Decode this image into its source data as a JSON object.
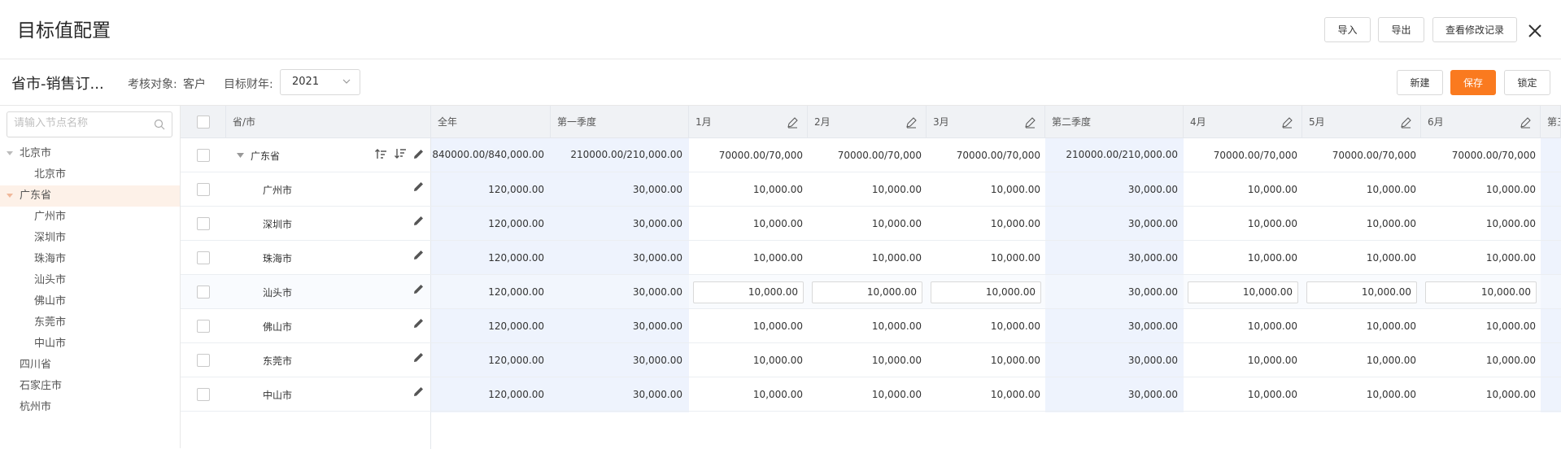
{
  "header": {
    "title": "目标值配置",
    "buttons": {
      "import": "导入",
      "export": "导出",
      "history": "查看修改记录"
    }
  },
  "toolbar": {
    "title": "省市-销售订...",
    "target_label": "考核对象:",
    "target_value": "客户",
    "year_label": "目标财年:",
    "year_value": "2021",
    "buttons": {
      "new": "新建",
      "save": "保存",
      "lock": "锁定"
    },
    "accent": "#fa7a1f"
  },
  "tree": {
    "search_placeholder": "请输入节点名称",
    "nodes": [
      {
        "label": "北京市"
      },
      {
        "label": "北京市"
      },
      {
        "label": "广东省"
      },
      {
        "label": "广州市"
      },
      {
        "label": "深圳市"
      },
      {
        "label": "珠海市"
      },
      {
        "label": "汕头市"
      },
      {
        "label": "佛山市"
      },
      {
        "label": "东莞市"
      },
      {
        "label": "中山市"
      },
      {
        "label": "四川省"
      },
      {
        "label": "石家庄市"
      },
      {
        "label": "杭州市"
      }
    ]
  },
  "table": {
    "name_header": "省/市",
    "columns": [
      "全年",
      "第一季度",
      "1月",
      "2月",
      "3月",
      "第二季度",
      "4月",
      "5月",
      "6月",
      "第三"
    ],
    "summary_row": {
      "name": "广东省",
      "values": [
        "840000.00/840,000.00",
        "210000.00/210,000.00",
        "70000.00/70,000",
        "70000.00/70,000",
        "70000.00/70,000",
        "210000.00/210,000.00",
        "70000.00/70,000",
        "70000.00/70,000",
        "70000.00/70,000"
      ]
    },
    "rows": [
      {
        "name": "广州市",
        "values": [
          "120,000.00",
          "30,000.00",
          "10,000.00",
          "10,000.00",
          "10,000.00",
          "30,000.00",
          "10,000.00",
          "10,000.00",
          "10,000.00"
        ]
      },
      {
        "name": "深圳市",
        "values": [
          "120,000.00",
          "30,000.00",
          "10,000.00",
          "10,000.00",
          "10,000.00",
          "30,000.00",
          "10,000.00",
          "10,000.00",
          "10,000.00"
        ]
      },
      {
        "name": "珠海市",
        "values": [
          "120,000.00",
          "30,000.00",
          "10,000.00",
          "10,000.00",
          "10,000.00",
          "30,000.00",
          "10,000.00",
          "10,000.00",
          "10,000.00"
        ]
      },
      {
        "name": "汕头市",
        "values": [
          "120,000.00",
          "30,000.00",
          "10,000.00",
          "10,000.00",
          "10,000.00",
          "30,000.00",
          "10,000.00",
          "10,000.00",
          "10,000.00"
        ]
      },
      {
        "name": "佛山市",
        "values": [
          "120,000.00",
          "30,000.00",
          "10,000.00",
          "10,000.00",
          "10,000.00",
          "30,000.00",
          "10,000.00",
          "10,000.00",
          "10,000.00"
        ]
      },
      {
        "name": "东莞市",
        "values": [
          "120,000.00",
          "30,000.00",
          "10,000.00",
          "10,000.00",
          "10,000.00",
          "30,000.00",
          "10,000.00",
          "10,000.00",
          "10,000.00"
        ]
      },
      {
        "name": "中山市",
        "values": [
          "120,000.00",
          "30,000.00",
          "10,000.00",
          "10,000.00",
          "10,000.00",
          "30,000.00",
          "10,000.00",
          "10,000.00",
          "10,000.00"
        ]
      }
    ]
  }
}
